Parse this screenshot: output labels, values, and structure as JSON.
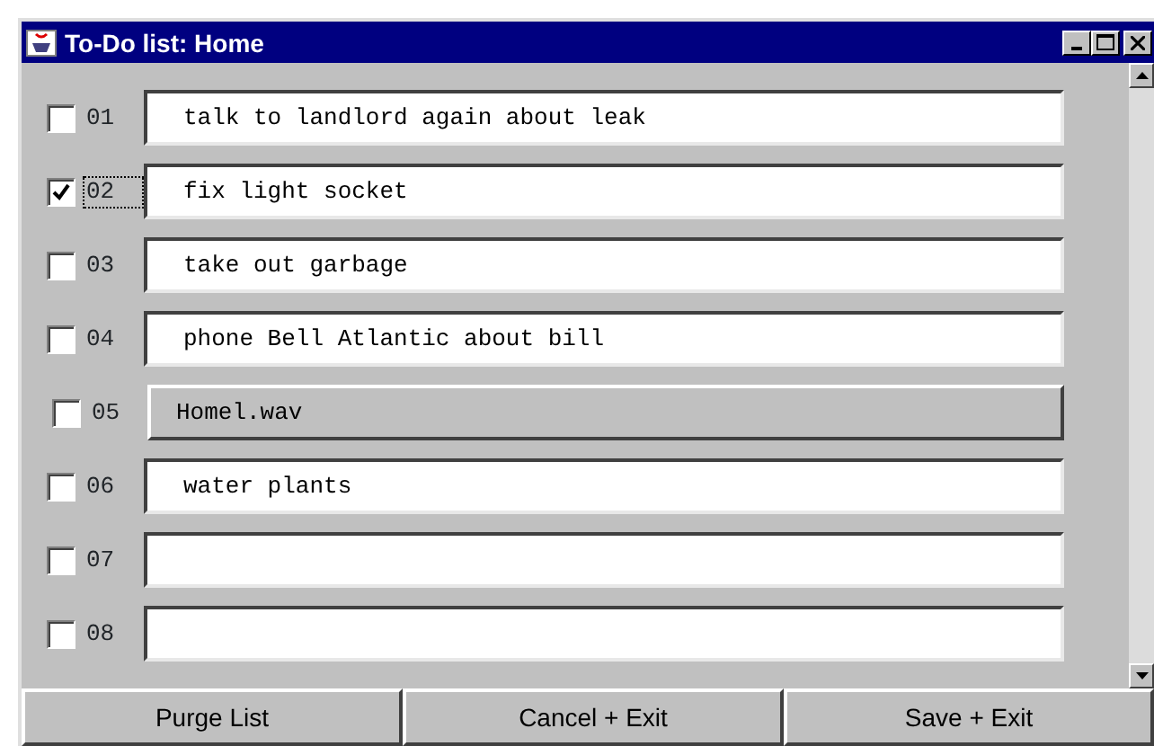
{
  "window": {
    "title": "To-Do list: Home"
  },
  "items": [
    {
      "number": "01",
      "checked": false,
      "focused": false,
      "kind": "text",
      "value": "talk to landlord again about leak"
    },
    {
      "number": "02",
      "checked": true,
      "focused": true,
      "kind": "text",
      "value": "fix light socket"
    },
    {
      "number": "03",
      "checked": false,
      "focused": false,
      "kind": "text",
      "value": "take out garbage"
    },
    {
      "number": "04",
      "checked": false,
      "focused": false,
      "kind": "text",
      "value": "phone Bell Atlantic about bill"
    },
    {
      "number": "05",
      "checked": false,
      "focused": false,
      "kind": "button",
      "value": "Homel.wav"
    },
    {
      "number": "06",
      "checked": false,
      "focused": false,
      "kind": "text",
      "value": "water plants"
    },
    {
      "number": "07",
      "checked": false,
      "focused": false,
      "kind": "text",
      "value": ""
    },
    {
      "number": "08",
      "checked": false,
      "focused": false,
      "kind": "text",
      "value": ""
    }
  ],
  "buttons": [
    "Purge List",
    "Cancel + Exit",
    "Save + Exit"
  ]
}
